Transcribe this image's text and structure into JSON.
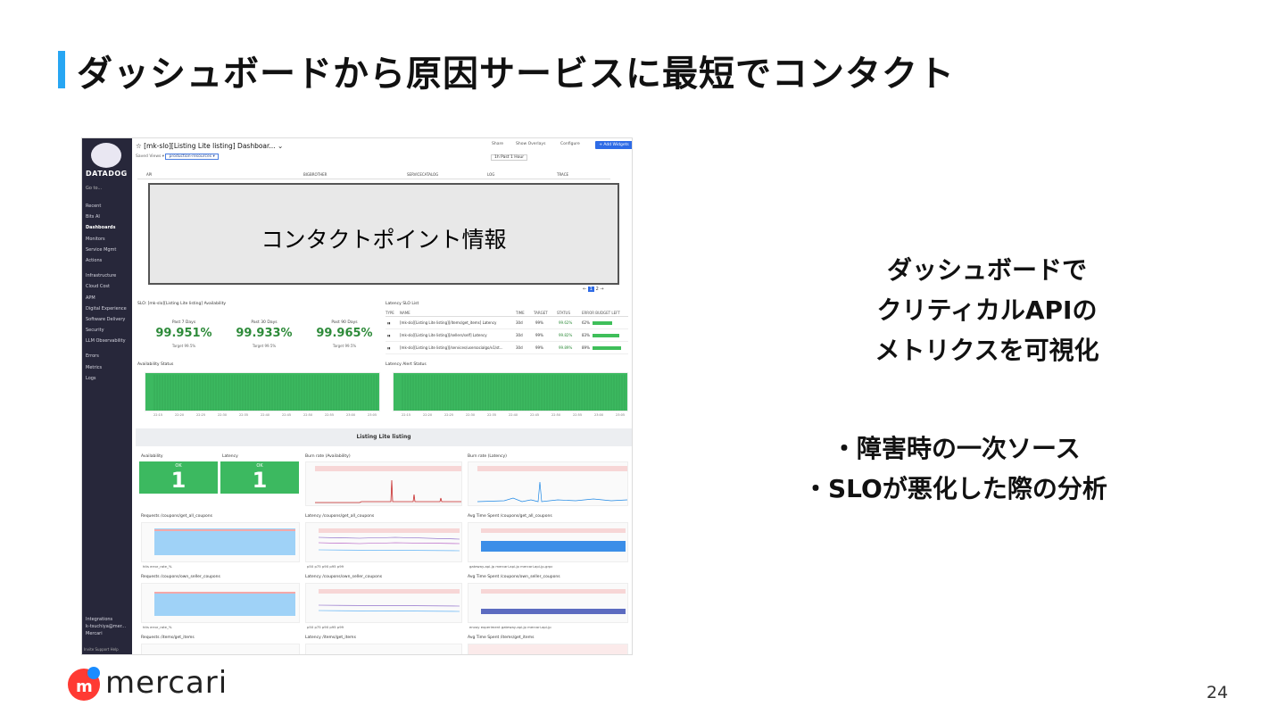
{
  "slide": {
    "title": "ダッシュボードから原因サービスに最短でコンタクト",
    "right_lines": [
      "ダッシュボードで",
      "クリティカルAPIの",
      "メトリクスを可視化"
    ],
    "bullets": [
      "・障害時の一次ソース",
      "・SLOが悪化した際の分析"
    ],
    "brand": "mercari",
    "page_number": "24",
    "accent_color": "#27a6f3"
  },
  "app": {
    "logo_text": "DATADOG",
    "go_to": "Go to...",
    "nav_items": [
      "Recent",
      "Bits AI",
      "Dashboards",
      "Monitors",
      "Service Mgmt",
      "Actions",
      "Infrastructure",
      "Cloud Cost",
      "APM",
      "Digital Experience",
      "Software Delivery",
      "Security",
      "LLM Observability",
      "Errors",
      "Metrics",
      "Logs"
    ],
    "nav_footer": [
      "Integrations",
      "k-tsuchiya@mer...",
      "Mercari"
    ],
    "nav_bottom": "Invite  Support  Help",
    "dashboard_title": "☆ [mk-slo][Listing Lite listing] Dashboar... ⌄",
    "share": "Share",
    "show_overlays": "Show Overlays",
    "configure": "Configure",
    "add_widgets": "+ Add Widgets",
    "saved_views": "Saved Views ▾",
    "scope": "production-resources ▾",
    "time_range": "Past 1 Hour",
    "time_short": "1h",
    "columns": [
      "API",
      "BIGBROTHER",
      "SERVICECATALOG",
      "LOG",
      "TRACE"
    ],
    "contact_label": "コンタクトポイント情報",
    "pager": [
      "←",
      "1",
      "2",
      "→"
    ]
  },
  "slo": {
    "title": "SLO: [mk-slo][Listing Lite listing] Availability",
    "kpis": [
      {
        "label": "Past 7 Days",
        "value": "99.951%",
        "target": "Target 99.5%"
      },
      {
        "label": "Past 30 Days",
        "value": "99.933%",
        "target": "Target 99.5%"
      },
      {
        "label": "Past 90 Days",
        "value": "99.965%",
        "target": "Target 99.5%"
      }
    ],
    "latency_title": "Latency SLO List",
    "table_headers": [
      "TYPE",
      "NAME",
      "TIME",
      "TARGET",
      "STATUS",
      "ERROR BUDGET LEFT"
    ],
    "rows": [
      {
        "name": "[mk-slo][Listing Lite listing][/items/get_items] Latency",
        "time": "30d",
        "target": "99%",
        "status": "99.62%",
        "budget": "62%",
        "budget_frac": 0.62
      },
      {
        "name": "[mk-slo][Listing Lite listing][/sellers/self] Latency",
        "time": "30d",
        "target": "99%",
        "status": "99.82%",
        "budget": "83%",
        "budget_frac": 0.83
      },
      {
        "name": "[mk-slo][Listing Lite listing][/services/usersocialgo/v1/st...",
        "time": "30d",
        "target": "99%",
        "status": "99.89%",
        "budget": "89%",
        "budget_frac": 0.89
      }
    ],
    "availability_status": "Availability Status",
    "latency_alert_status": "Latency Alert Status",
    "axis_times": [
      "22:15",
      "22:20",
      "22:25",
      "22:30",
      "22:35",
      "22:40",
      "22:45",
      "22:50",
      "22:55",
      "23:00",
      "23:05"
    ]
  },
  "section": {
    "title": "Listing Lite listing",
    "availability": "Availability",
    "latency": "Latency",
    "ok": "OK",
    "ok_value": "1",
    "burn_availability": "Burn rate (Availability)",
    "burn_latency": "Burn rate (Latency)",
    "req1": "Requests /coupons/get_all_coupons",
    "lat1": "Latency /coupons/get_all_coupons",
    "avg1": "Avg Time Spent /coupons/get_all_coupons",
    "req2": "Requests /coupons/own_seller_coupons",
    "lat2": "Latency /coupons/own_seller_coupons",
    "avg2": "Avg Time Spent /coupons/own_seller_coupons",
    "req3": "Requests /items/get_items",
    "lat3": "Latency /items/get_items",
    "avg3": "Avg Time Spent /items/get_items",
    "legend_req": "hits   error_rate_%",
    "legend_lat": "p50  p75  p90  p95  p99",
    "legend_avg1": "gateway-api-jp   mercari-api-jp   mercari-api-jp-grpc",
    "legend_avg2": "envoy   experiment   gateway-api-jp   mercari-api-jp",
    "chart_times": [
      "22:15",
      "22:30",
      "22:45",
      "23:00"
    ]
  }
}
